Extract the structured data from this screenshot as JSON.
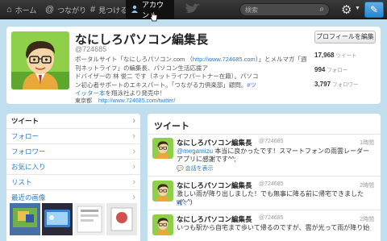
{
  "topbar": {
    "home": "ホーム",
    "connect": "つながり",
    "discover": "見つける",
    "account": "アカウント",
    "search_placeholder": "検索"
  },
  "profile": {
    "name": "なにしろパソコン編集長",
    "handle": "@724685",
    "bio_lines": [
      [
        "ポータルサイト「なにしろパソコン.com （",
        "http://www.724685.com",
        "）」とメルマガ「週刊ネットライフ」の編集長、パソコン生活応援ア"
      ],
      [
        "ドバイザーの 林 俊二 です（ネットライフパートナー在籍）。パソコ"
      ],
      [
        "ン初心者サポートのエキスパート。「つながる力倶楽部」顧問。",
        "#ツ"
      ],
      [
        "イッター本",
        "を翔泳社より発売中！"
      ]
    ],
    "location": "東京都",
    "url": "http://www.724685.com/twitter/",
    "edit_button": "プロフィールを編集",
    "stats": [
      {
        "value": "17,968",
        "label": "ツイート"
      },
      {
        "value": "994",
        "label": "フォロー"
      },
      {
        "value": "3,797",
        "label": "フォロワー"
      }
    ]
  },
  "sidebar": {
    "items": [
      {
        "label": "ツイート",
        "active": true
      },
      {
        "label": "フォロー",
        "active": false
      },
      {
        "label": "フォロワー",
        "active": false
      },
      {
        "label": "お気に入り",
        "active": false
      },
      {
        "label": "リスト",
        "active": false
      },
      {
        "label": "最近の画像",
        "active": false
      }
    ]
  },
  "timeline": {
    "heading": "ツイート",
    "tweets": [
      {
        "name": "なにしろパソコン編集長",
        "handle": "@724685",
        "time": "1時間",
        "mention": "@megamizu",
        "text_after_mention": " 本当に良かったです！スマートフォンの雨雲レーダーアプリに感謝です^^;",
        "expand": "会話を表示"
      },
      {
        "name": "なにしろパソコン編集長",
        "handle": "@724685",
        "time": "2時間",
        "text": "激しい雨が降り出しました！でも無事に降る前に帰宅できました v(^-^)",
        "expand": "開く"
      },
      {
        "name": "なにしろパソコン編集長",
        "handle": "@724685",
        "time": "2時間",
        "text": "いつも駅から自宅まで歩いて帰るのですが、雲が光って雨が降り始"
      }
    ]
  }
}
